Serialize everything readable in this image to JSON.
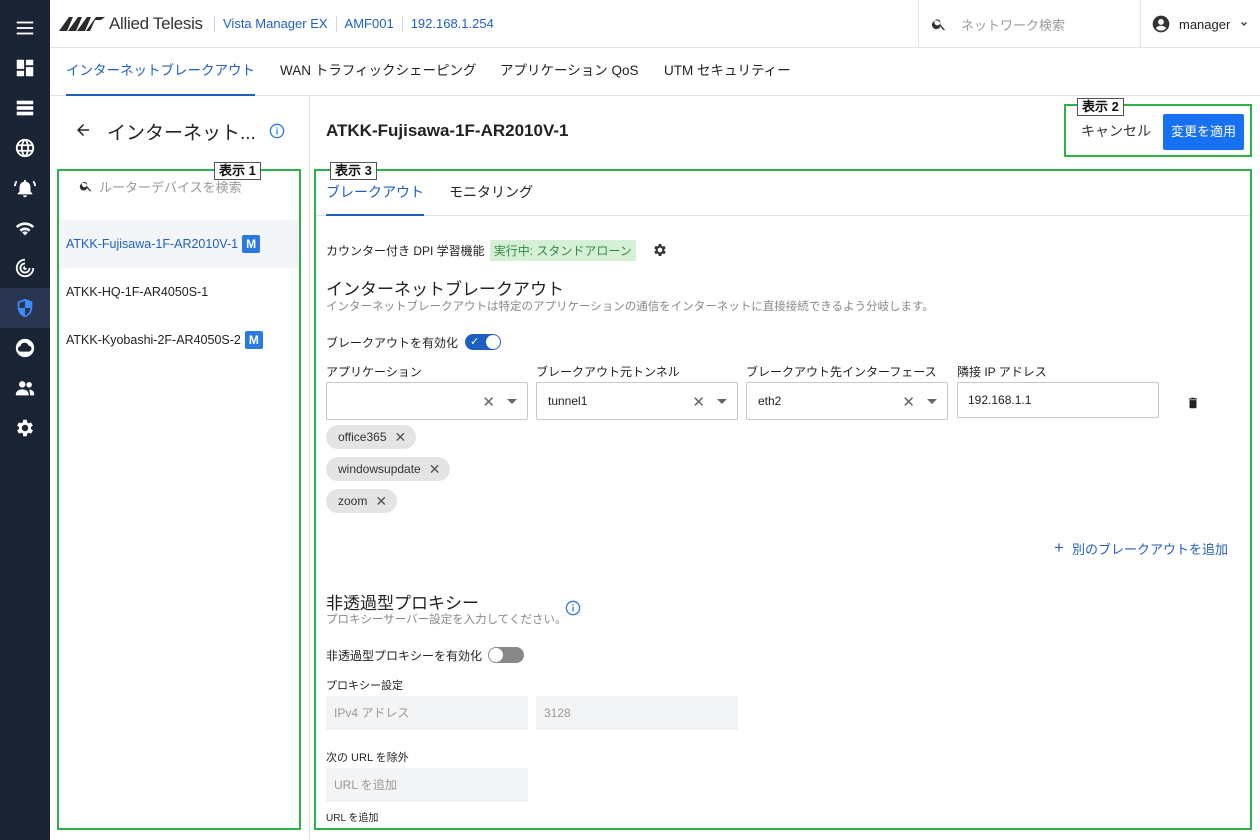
{
  "app": {
    "brand": "Allied Telesis",
    "product": "Vista Manager EX",
    "crumbs": [
      "Vista Manager EX",
      "AMF001",
      "192.168.1.254"
    ],
    "search_placeholder": "ネットワーク検索",
    "user": "manager"
  },
  "rail": [
    "menu-icon",
    "dashboard-icon",
    "list-icon",
    "globe-icon",
    "alarm-bell-icon",
    "wifi-icon",
    "radar-icon",
    "shield-icon",
    "cloud-icon",
    "users-icon",
    "settings-gear-icon"
  ],
  "top_tabs": [
    "インターネットブレークアウト",
    "WAN トラフィックシェーピング",
    "アプリケーション QoS",
    "UTM セキュリティー"
  ],
  "left_panel": {
    "title": "インターネット...",
    "search_placeholder": "ルーターデバイスを検索",
    "devices": [
      {
        "name": "ATKK-Fujisawa-1F-AR2010V-1",
        "badge": "M",
        "selected": true
      },
      {
        "name": "ATKK-HQ-1F-AR4050S-1",
        "badge": "",
        "selected": false
      },
      {
        "name": "ATKK-Kyobashi-2F-AR4050S-2",
        "badge": "M",
        "selected": false
      }
    ]
  },
  "annotations": {
    "box1": "表示 1",
    "box2": "表示 2",
    "box3": "表示 3"
  },
  "detail": {
    "device": "ATKK-Fujisawa-1F-AR2010V-1",
    "cancel": "キャンセル",
    "apply": "変更を適用",
    "sub_tabs": [
      "ブレークアウト",
      "モニタリング"
    ],
    "dpi_label": "カウンター付き DPI 学習機能",
    "dpi_status": "実行中: スタンドアローン",
    "breakout": {
      "title": "インターネットブレークアウト",
      "desc": "インターネットブレークアウトは特定のアプリケーションの通信をインターネットに直接接続できるよう分岐します。",
      "enable_label": "ブレークアウトを有効化",
      "enabled": true,
      "fields": {
        "app_label": "アプリケーション",
        "tunnel_label": "ブレークアウト元トンネル",
        "iface_label": "ブレークアウト先インターフェース",
        "ip_label": "隣接 IP アドレス",
        "app_value": "",
        "tunnel_value": "tunnel1",
        "iface_value": "eth2",
        "ip_value": "192.168.1.1"
      },
      "chips": [
        "office365",
        "windowsupdate",
        "zoom"
      ],
      "add_link": "別のブレークアウトを追加"
    },
    "proxy": {
      "title": "非透過型プロキシー",
      "desc": "プロキシーサーバー設定を入力してください。",
      "enable_label": "非透過型プロキシーを有効化",
      "enabled": false,
      "settings_label": "プロキシー設定",
      "ipv4_placeholder": "IPv4 アドレス",
      "port_value": "3128",
      "exclude_label": "次の URL を除外",
      "url_placeholder": "URL を追加",
      "url_hint": "URL を追加"
    }
  },
  "colors": {
    "accent": "#1f5fc4",
    "rail": "#1b2435",
    "annotation_green": "#2db24a",
    "apply": "#1672f3"
  }
}
